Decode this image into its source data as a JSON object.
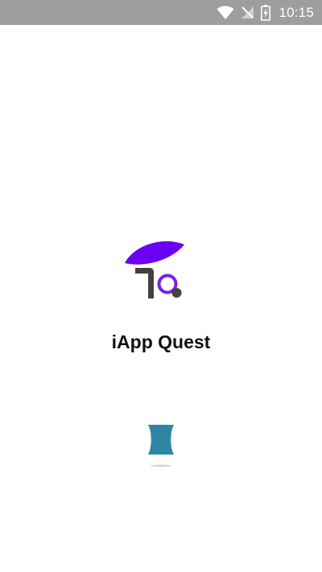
{
  "status_bar": {
    "time": "10:15",
    "icons": [
      "wifi-icon",
      "no-signal-icon",
      "battery-charging-icon"
    ],
    "background": "#9e9e9e"
  },
  "splash": {
    "app_name": "iApp Quest",
    "logo_colors": {
      "leaf": "#6a00f4",
      "mark": "#424242",
      "ring": "#7b1fe0"
    }
  },
  "loader": {
    "color": "#2e86a5"
  }
}
